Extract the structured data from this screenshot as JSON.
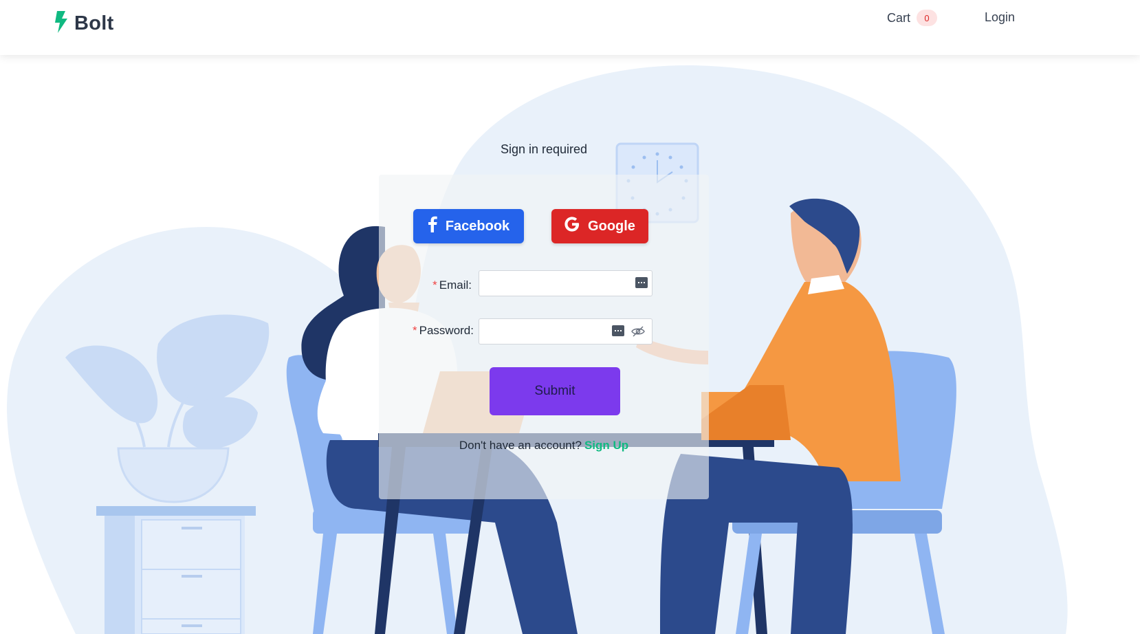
{
  "header": {
    "brand": "Bolt",
    "cart_label": "Cart",
    "cart_count": "0",
    "login_label": "Login"
  },
  "form": {
    "title": "Sign in required",
    "facebook_label": "Facebook",
    "google_label": "Google",
    "email_label": "Email",
    "password_label": "Password",
    "required_mark": "*",
    "email_value": "",
    "password_value": "",
    "submit_label": "Submit",
    "no_account_text": "Don't have an account?",
    "signup_label": "Sign Up"
  },
  "icons": {
    "logo": "lightning-bolt-icon",
    "facebook": "facebook-icon",
    "google": "google-icon",
    "autofill": "keyboard-icon",
    "password_toggle": "eye-slash-icon"
  },
  "colors": {
    "brand_green": "#10b981",
    "facebook_blue": "#2563eb",
    "google_red": "#dc2626",
    "submit_purple": "#7c3aed",
    "shirt_orange": "#f59842",
    "chair_blue": "#8fb5f2"
  }
}
